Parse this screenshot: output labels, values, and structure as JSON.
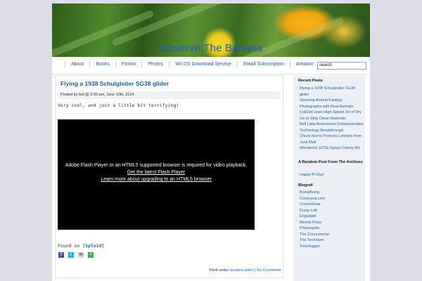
{
  "site": {
    "title": "Observe The Banana"
  },
  "nav": {
    "items": [
      "About",
      "Books",
      "Fiction",
      "Photos",
      "Wii DS Download Service",
      "Email Subscription",
      "Amazon"
    ]
  },
  "search": {
    "value": "search"
  },
  "post": {
    "title": "Flying a 1938 Schulgleiter SG38 glider",
    "meta": "Posted by ted @ 2:09 am, June 10th, 2014",
    "body": "Very cool, and just a little bit terrifying!",
    "video": {
      "message": "Adobe Flash Player or an HTML5 supported browser is required for video playback.",
      "link1": "Get the latest Flash Player",
      "link2": "Learn more about upgrading to an HTML5 browser"
    },
    "found_on_prefix": "Found on [",
    "found_on_source": "Sploid",
    "found_on_suffix": "]",
    "share_icons": [
      "facebook-icon",
      "twitter-icon",
      "email-icon",
      "share-icon"
    ],
    "filed_prefix": "Filed under ",
    "categories": "aviation,video",
    "separator": " | ",
    "comments": "No Comments"
  },
  "sidebar": {
    "recent_heading": "Recent Posts",
    "recent_posts": [
      "Flying a 1938 Schulgleiter SG38 glider",
      "Stunning Animal Fantasy Photographs with Real Animals",
      "ColdJet Uses High Speed Jet of Dry Ice to Strip Clean Materials",
      "Bell Labs Announces Communication Technology Breakthrough",
      "Chuck Norris Protects Latvians from Junk Mail",
      "Wonderful 1970s Space Colony Art"
    ],
    "random_heading": "A Random Post From The Archives",
    "random_post": "Happy Pi Day!",
    "blogroll_heading": "Blogroll",
    "blogroll": [
      "BoingBoing",
      "Cockeyed.com",
      "CrunchGear",
      "Dusty Loft",
      "Engadget",
      "Mental Floss",
      "Pharyngula",
      "The Consumerist",
      "The Technium",
      "TreeHugger"
    ]
  },
  "colors": {
    "link": "#1f5fa8",
    "page_bg": "#dcdde7",
    "sidebar_bg": "#eceff5"
  }
}
